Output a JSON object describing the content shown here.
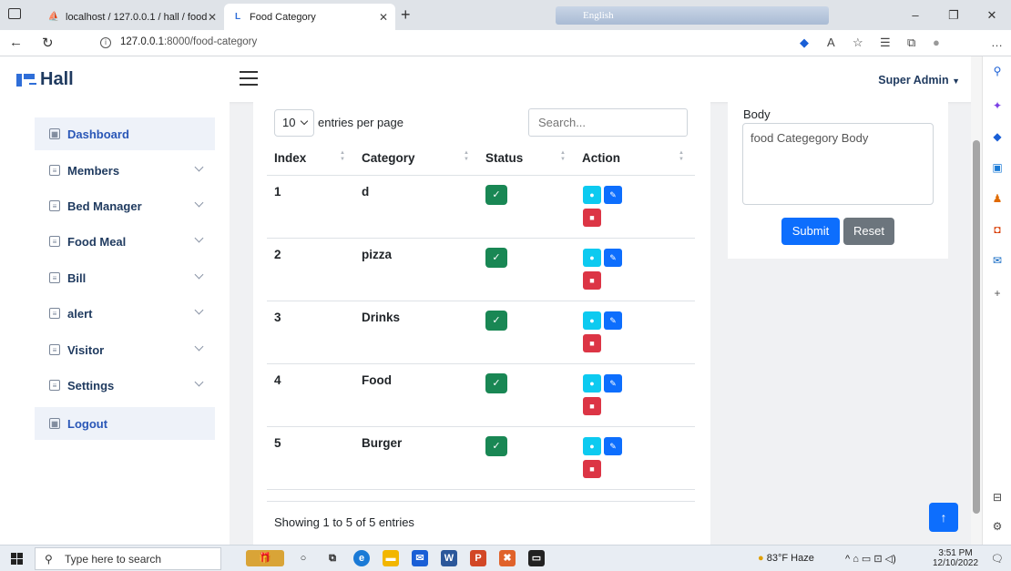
{
  "browser": {
    "tabs": [
      {
        "label": "localhost / 127.0.0.1 / hall / food",
        "icon": "phpmyadmin-icon"
      },
      {
        "label": "Food Category",
        "icon": "hall-logo-icon"
      }
    ],
    "language_bar": "English",
    "url_host": "127.0.0.1",
    "url_rest": ":8000/food-category"
  },
  "header": {
    "brand": "Hall",
    "user": "Super Admin"
  },
  "sidebar": {
    "items": [
      {
        "label": "Dashboard",
        "expandable": false
      },
      {
        "label": "Members",
        "expandable": true
      },
      {
        "label": "Bed Manager",
        "expandable": true
      },
      {
        "label": "Food Meal",
        "expandable": true
      },
      {
        "label": "Bill",
        "expandable": true
      },
      {
        "label": "alert",
        "expandable": true
      },
      {
        "label": "Visitor",
        "expandable": true
      },
      {
        "label": "Settings",
        "expandable": true
      },
      {
        "label": "Logout",
        "expandable": false
      }
    ]
  },
  "table": {
    "page_size": "10",
    "page_size_label": "entries per page",
    "search_placeholder": "Search...",
    "columns": [
      "Index",
      "Category",
      "Status",
      "Action"
    ],
    "rows": [
      {
        "index": "1",
        "category": "d"
      },
      {
        "index": "2",
        "category": "pizza"
      },
      {
        "index": "3",
        "category": "Drinks"
      },
      {
        "index": "4",
        "category": "Food"
      },
      {
        "index": "5",
        "category": "Burger"
      }
    ],
    "footer": "Showing 1 to 5 of 5 entries"
  },
  "form": {
    "body_label": "Body",
    "body_value": "food Categegory Body",
    "submit_label": "Submit",
    "reset_label": "Reset"
  },
  "taskbar": {
    "search_placeholder": "Type here to search",
    "weather": "83°F  Haze",
    "time": "3:51 PM",
    "date": "12/10/2022"
  },
  "colors": {
    "primary": "#0d6efd",
    "success": "#198754",
    "info": "#0dcaf0",
    "danger": "#dc3545",
    "secondary": "#6c757d"
  }
}
